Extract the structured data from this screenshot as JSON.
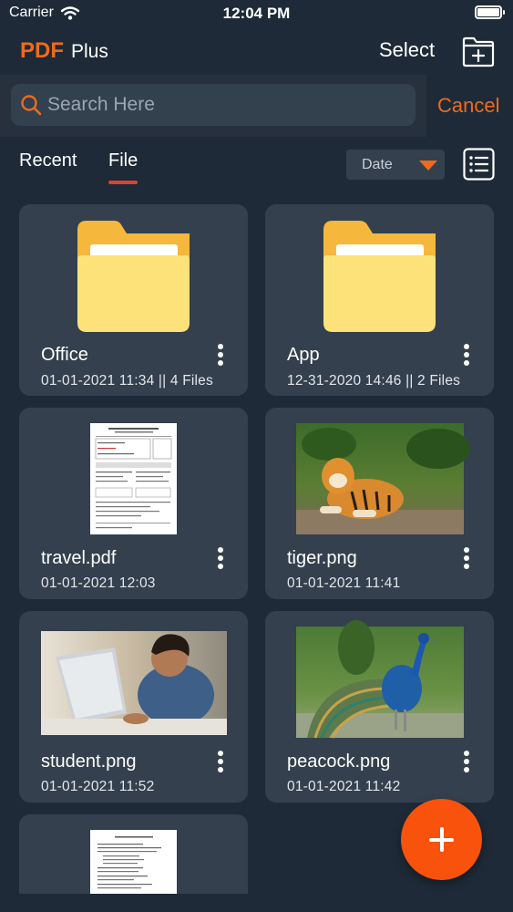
{
  "status_bar": {
    "carrier": "Carrier",
    "time": "12:04 PM"
  },
  "header": {
    "brand_main": "PDF",
    "brand_sub": "Plus",
    "select_label": "Select",
    "new_folder_icon": "folder-plus-icon"
  },
  "search": {
    "placeholder": "Search Here",
    "value": "",
    "cancel_label": "Cancel"
  },
  "tabs": [
    {
      "label": "Recent"
    },
    {
      "label": "File",
      "active": true
    }
  ],
  "sort": {
    "selected": "Date"
  },
  "files": [
    {
      "name": "Office",
      "meta": "01-01-2021 11:34 || 4 Files",
      "type": "folder"
    },
    {
      "name": "App",
      "meta": "12-31-2020 14:46 || 2 Files",
      "type": "folder"
    },
    {
      "name": "travel.pdf",
      "meta": "01-01-2021 12:03",
      "type": "pdf"
    },
    {
      "name": "tiger.png",
      "meta": "01-01-2021 11:41",
      "type": "image"
    },
    {
      "name": "student.png",
      "meta": "01-01-2021 11:52",
      "type": "image"
    },
    {
      "name": "peacock.png",
      "meta": "01-01-2021 11:42",
      "type": "image"
    },
    {
      "name": "",
      "meta": "",
      "type": "pdf"
    }
  ],
  "colors": {
    "accent": "#f06a1a",
    "background": "#1e2a37",
    "card": "#34404d",
    "fab": "#f8520d",
    "folder": "#fde27a",
    "tab_indicator": "#e53e2a"
  }
}
